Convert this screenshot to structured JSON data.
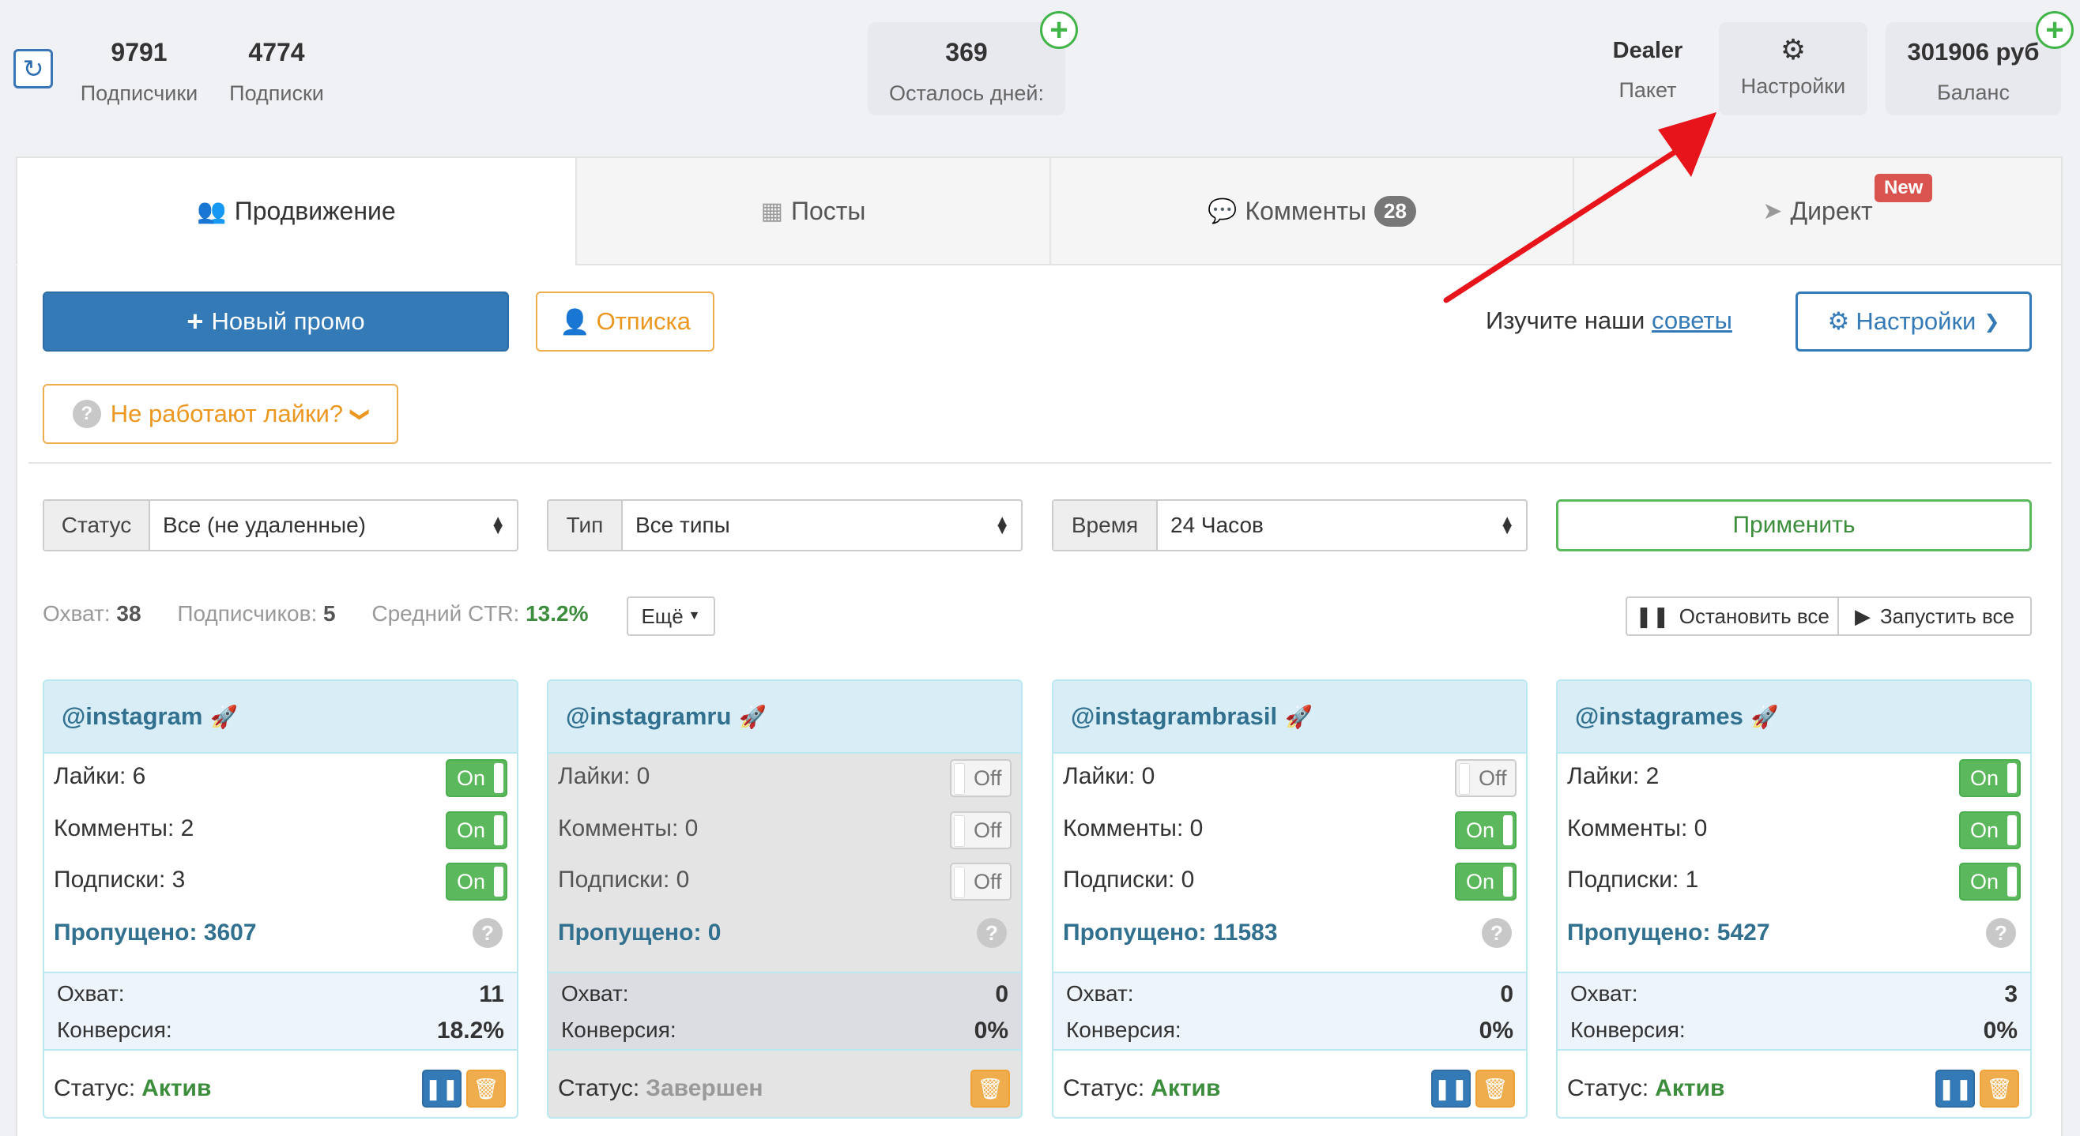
{
  "topbar": {
    "subscribers": {
      "value": "9791",
      "label": "Подписчики"
    },
    "subscriptions": {
      "value": "4774",
      "label": "Подписки"
    },
    "days_left": {
      "value": "369",
      "label": "Осталось дней:"
    },
    "package": {
      "value": "Dealer",
      "label": "Пакет"
    },
    "settings": {
      "label": "Настройки",
      "icon": "gear-icon"
    },
    "balance": {
      "value": "301906 руб",
      "label": "Баланс"
    }
  },
  "tabs": [
    {
      "label": "Продвижение",
      "icon": "users-icon",
      "active": true
    },
    {
      "label": "Посты",
      "icon": "grid-icon"
    },
    {
      "label": "Комменты",
      "icon": "comments-icon",
      "badge": "28"
    },
    {
      "label": "Директ",
      "icon": "send-icon",
      "new_badge": "New"
    }
  ],
  "actions": {
    "new_promo": "Новый промо",
    "unsubscribe": "Отписка",
    "likes_not_working": "Не работают лайки?",
    "tips_prefix": "Изучите наши",
    "tips_link": "советы",
    "settings": "Настройки"
  },
  "filters": {
    "status": {
      "label": "Статус",
      "value": "Все (не удаленные)"
    },
    "type": {
      "label": "Тип",
      "value": "Все типы"
    },
    "time": {
      "label": "Время",
      "value": "24 Часов"
    },
    "apply": "Применить"
  },
  "summary": {
    "reach_label": "Охват:",
    "reach": "38",
    "subs_label": "Подписчиков:",
    "subs": "5",
    "ctr_label": "Средний CTR:",
    "ctr": "13.2%",
    "more": "Ещё",
    "stop_all": "Остановить все",
    "start_all": "Запустить все"
  },
  "cards": [
    {
      "account": "@instagram",
      "likes": "Лайки: 6",
      "comments": "Комменты: 2",
      "subs": "Подписки: 3",
      "likes_t": "On",
      "comments_t": "On",
      "subs_t": "On",
      "skipped": "Пропущено: 3607",
      "reach_label": "Охват:",
      "reach": "11",
      "conv_label": "Конверсия:",
      "conv": "18.2%",
      "status_label": "Статус:",
      "status": "Актив"
    },
    {
      "account": "@instagramru",
      "likes": "Лайки: 0",
      "comments": "Комменты: 0",
      "subs": "Подписки: 0",
      "likes_t": "Off",
      "comments_t": "Off",
      "subs_t": "Off",
      "skipped": "Пропущено: 0",
      "reach_label": "Охват:",
      "reach": "0",
      "conv_label": "Конверсия:",
      "conv": "0%",
      "status_label": "Статус:",
      "status": "Завершен"
    },
    {
      "account": "@instagrambrasil",
      "likes": "Лайки: 0",
      "comments": "Комменты: 0",
      "subs": "Подписки: 0",
      "likes_t": "Off",
      "comments_t": "On",
      "subs_t": "On",
      "skipped": "Пропущено: 11583",
      "reach_label": "Охват:",
      "reach": "0",
      "conv_label": "Конверсия:",
      "conv": "0%",
      "status_label": "Статус:",
      "status": "Актив"
    },
    {
      "account": "@instagrames",
      "likes": "Лайки: 2",
      "comments": "Комменты: 0",
      "subs": "Подписки: 1",
      "likes_t": "On",
      "comments_t": "On",
      "subs_t": "On",
      "skipped": "Пропущено: 5427",
      "reach_label": "Охват:",
      "reach": "3",
      "conv_label": "Конверсия:",
      "conv": "0%",
      "status_label": "Статус:",
      "status": "Актив"
    }
  ],
  "colors": {
    "primary": "#337ab7",
    "success": "#5cb85c",
    "warning": "#f0ad4e",
    "danger": "#d9534f",
    "arrow": "#e8141b"
  }
}
